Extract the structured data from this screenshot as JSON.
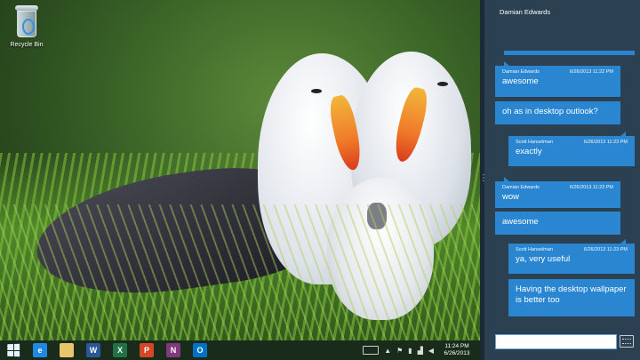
{
  "desktop": {
    "recycle_bin_label": "Recycle Bin"
  },
  "taskbar": {
    "apps": [
      {
        "name": "internet-explorer-icon",
        "glyph": "e",
        "color": "#1e88e5"
      },
      {
        "name": "file-explorer-icon",
        "glyph": "",
        "color": "#e8c46a"
      },
      {
        "name": "word-icon",
        "glyph": "W",
        "color": "#2b579a"
      },
      {
        "name": "excel-icon",
        "glyph": "X",
        "color": "#217346"
      },
      {
        "name": "powerpoint-icon",
        "glyph": "P",
        "color": "#d24726"
      },
      {
        "name": "onenote-icon",
        "glyph": "N",
        "color": "#80397b"
      },
      {
        "name": "outlook-icon",
        "glyph": "O",
        "color": "#0072c6"
      }
    ],
    "time": "11:24 PM",
    "date": "6/26/2013"
  },
  "messaging": {
    "contact": "Damian Edwards",
    "messages": [
      {
        "sender": "Damian Edwards",
        "time": "6/26/2013 11:22 PM",
        "text": "awesome",
        "side": "left"
      },
      {
        "sender": "",
        "time": "",
        "text": "oh as in desktop outlook?",
        "side": "left"
      },
      {
        "sender": "Scott Hanselman",
        "time": "6/26/2013 11:23 PM",
        "text": "exactly",
        "side": "right"
      },
      {
        "sender": "Damian Edwards",
        "time": "6/26/2013 11:23 PM",
        "text": "wow",
        "side": "left"
      },
      {
        "sender": "",
        "time": "",
        "text": "awesome",
        "side": "left"
      },
      {
        "sender": "Scott Hanselman",
        "time": "6/26/2013 11:23 PM",
        "text": "ya, very useful",
        "side": "right"
      },
      {
        "sender": "",
        "time": "",
        "text": "Having the desktop wallpaper is better too",
        "side": "right"
      }
    ],
    "input_value": ""
  },
  "colors": {
    "bubble": "#2a86d1",
    "app_background": "#2b4050"
  }
}
